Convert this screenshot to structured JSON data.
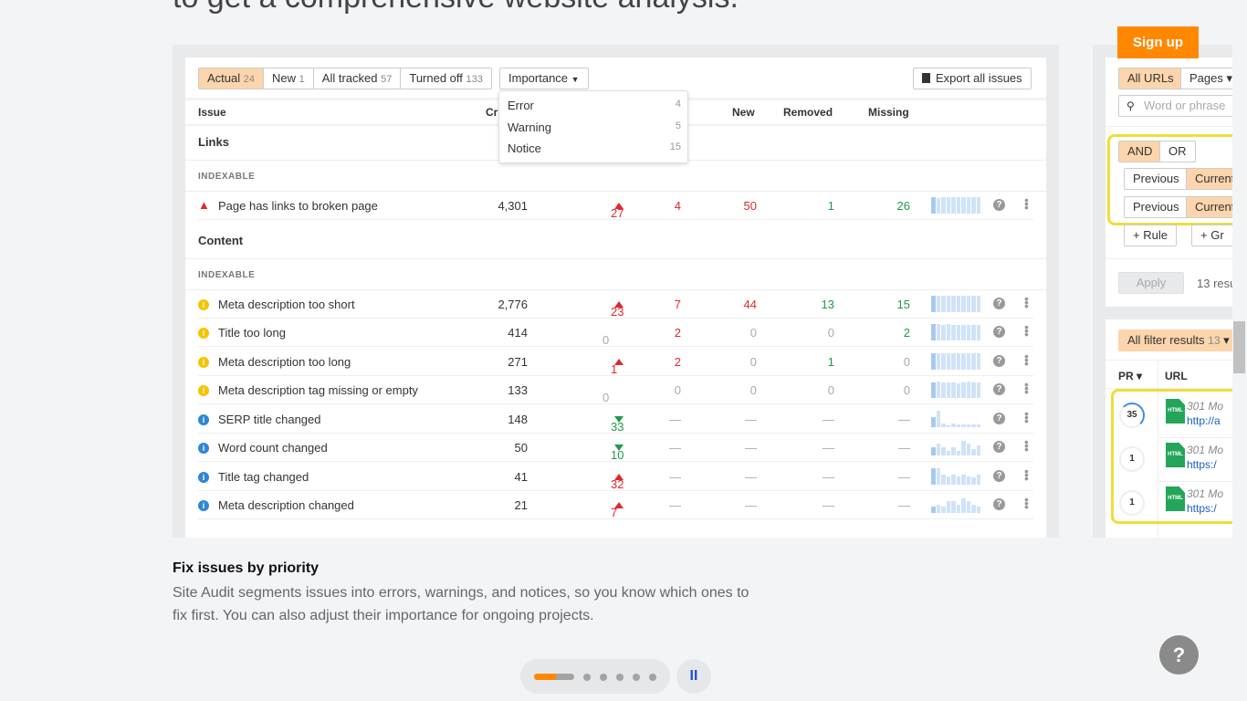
{
  "headline": "to get a comprehensive website analysis.",
  "tabs": [
    {
      "label": "Actual",
      "count": "24",
      "active": true
    },
    {
      "label": "New",
      "count": "1"
    },
    {
      "label": "All tracked",
      "count": "57"
    },
    {
      "label": "Turned off",
      "count": "133"
    }
  ],
  "importance": {
    "label": "Importance",
    "options": [
      {
        "label": "Error",
        "count": "4"
      },
      {
        "label": "Warning",
        "count": "5"
      },
      {
        "label": "Notice",
        "count": "15"
      }
    ]
  },
  "export_label": "Export all issues",
  "headers": {
    "issue": "Issue",
    "crawled": "Cr",
    "new": "New",
    "removed": "Removed",
    "missing": "Missing"
  },
  "sections": [
    {
      "title": "Links",
      "group": "INDEXABLE",
      "rows": [
        {
          "type": "error",
          "issue": "Page has links to broken page",
          "crawled": "4,301",
          "change": "27",
          "dir": "up",
          "c4": "4",
          "new": "50",
          "removed": "1",
          "missing": "26",
          "spark": [
            1,
            0.95,
            1,
            1,
            1,
            1,
            1,
            1,
            1,
            1
          ]
        }
      ]
    },
    {
      "title": "Content",
      "group": "INDEXABLE",
      "rows": [
        {
          "type": "warning",
          "issue": "Meta description too short",
          "crawled": "2,776",
          "change": "23",
          "dir": "up",
          "c4": "7",
          "new": "44",
          "removed": "13",
          "missing": "15",
          "spark": [
            1,
            0.95,
            1,
            1,
            0.95,
            1,
            1,
            1,
            1,
            0.95
          ]
        },
        {
          "type": "warning",
          "issue": "Title too long",
          "crawled": "414",
          "change": "0",
          "dir": "",
          "c4": "2",
          "new": "0",
          "removed": "0",
          "missing": "2",
          "spark": [
            1,
            1,
            0.95,
            1,
            0.95,
            0.95,
            0.95,
            0.95,
            0.95,
            0.95
          ]
        },
        {
          "type": "warning",
          "issue": "Meta description too long",
          "crawled": "271",
          "change": "1",
          "dir": "up",
          "c4": "2",
          "new": "0",
          "removed": "1",
          "missing": "0",
          "spark": [
            1,
            1,
            1,
            1,
            0.95,
            0.95,
            0.95,
            0.95,
            0.95,
            0.95
          ]
        },
        {
          "type": "warning",
          "issue": "Meta description tag missing or empty",
          "crawled": "133",
          "change": "0",
          "dir": "",
          "c4": "0",
          "new": "0",
          "removed": "0",
          "missing": "0",
          "spark": [
            0.95,
            1,
            0.95,
            0.95,
            0.95,
            0.9,
            0.95,
            1,
            0.95,
            0.95
          ]
        },
        {
          "type": "notice",
          "issue": "SERP title changed",
          "crawled": "148",
          "change": "33",
          "dir": "down",
          "c4": "—",
          "new": "—",
          "removed": "—",
          "missing": "—",
          "spark": [
            0.6,
            1,
            0.2,
            0.1,
            0.2,
            0.12,
            0.12,
            0.12,
            0.12,
            0.12
          ]
        },
        {
          "type": "notice",
          "issue": "Word count changed",
          "crawled": "50",
          "change": "10",
          "dir": "down",
          "c4": "—",
          "new": "—",
          "removed": "—",
          "missing": "—",
          "spark": [
            0.5,
            0.7,
            0.5,
            0.3,
            0.5,
            0.3,
            0.9,
            0.7,
            0.4,
            0.6
          ]
        },
        {
          "type": "notice",
          "issue": "Title tag changed",
          "crawled": "41",
          "change": "32",
          "dir": "up",
          "c4": "—",
          "new": "—",
          "removed": "—",
          "missing": "—",
          "spark": [
            1,
            1,
            0.6,
            0.5,
            0.6,
            0.5,
            0.6,
            0.5,
            0.4,
            0.6
          ]
        },
        {
          "type": "notice",
          "issue": "Meta description changed",
          "crawled": "21",
          "change": "7",
          "dir": "up",
          "c4": "—",
          "new": "—",
          "removed": "—",
          "missing": "—",
          "spark": [
            0.4,
            0.5,
            0.4,
            0.7,
            0.7,
            0.5,
            0.9,
            0.7,
            0.5,
            0.4
          ]
        }
      ]
    }
  ],
  "right": {
    "signup": "Sign up",
    "all_urls": "All URLs",
    "pages": "Pages ▾",
    "search_placeholder": "Word or phrase",
    "and": "AND",
    "or": "OR",
    "previous": "Previous",
    "current": "Current",
    "rule": "+ Rule",
    "group": "+ Gr",
    "apply": "Apply",
    "results": "13 resu",
    "filter_results": "All filter results",
    "filter_count": "13",
    "pr": "PR ▾",
    "url": "URL",
    "rows": [
      {
        "pr": "35",
        "status": "301 Mo",
        "url": "http://a"
      },
      {
        "pr": "1",
        "status": "301 Mo",
        "url": "https:/"
      },
      {
        "pr": "1",
        "status": "301 Mo",
        "url": "https:/"
      }
    ]
  },
  "feature": {
    "title": "Fix issues by priority",
    "desc": "Site Audit segments issues into errors, warnings, and notices, so you know which ones to fix first. You can also adjust their importance for ongoing projects."
  },
  "carousel": {
    "slides": 6,
    "active": 0,
    "progress": 0.55,
    "pause": "II"
  },
  "help": "?",
  "colors": {
    "accent": "#ff8800",
    "error": "#e0282c",
    "good": "#1e9a4a",
    "warning": "#f5c400",
    "notice": "#2f86d6",
    "highlight": "#f0dd3c"
  }
}
